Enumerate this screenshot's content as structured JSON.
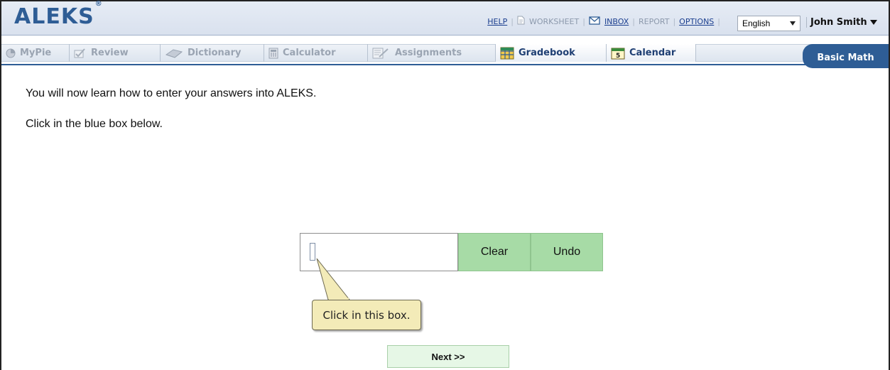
{
  "header": {
    "logo": "ALEKS",
    "logo_mark": "®",
    "links": {
      "help": "HELP",
      "worksheet": "WORKSHEET",
      "inbox": "INBOX",
      "report": "REPORT",
      "options": "OPTIONS"
    },
    "language": "English",
    "user": "John Smith"
  },
  "nav": {
    "tabs": [
      {
        "label": "MyPie",
        "icon": "pie-icon"
      },
      {
        "label": "Review",
        "icon": "check-icon"
      },
      {
        "label": "Dictionary",
        "icon": "book-icon"
      },
      {
        "label": "Calculator",
        "icon": "calculator-icon"
      },
      {
        "label": "Assignments",
        "icon": "assignment-icon"
      },
      {
        "label": "Gradebook",
        "icon": "gradebook-icon"
      },
      {
        "label": "Calendar",
        "icon": "calendar-icon"
      }
    ],
    "course": "Basic Math"
  },
  "content": {
    "instruction1": "You will now learn how to enter your answers into ALEKS.",
    "instruction2": "Click in the blue box below.",
    "clear_label": "Clear",
    "undo_label": "Undo",
    "tooltip": "Click in this box.",
    "next_label": "Next >>"
  },
  "colors": {
    "brand_blue": "#2e5d95",
    "button_green": "#a7dba6",
    "next_green": "#e6f7e6",
    "tooltip_yellow": "#f3ebb8"
  }
}
